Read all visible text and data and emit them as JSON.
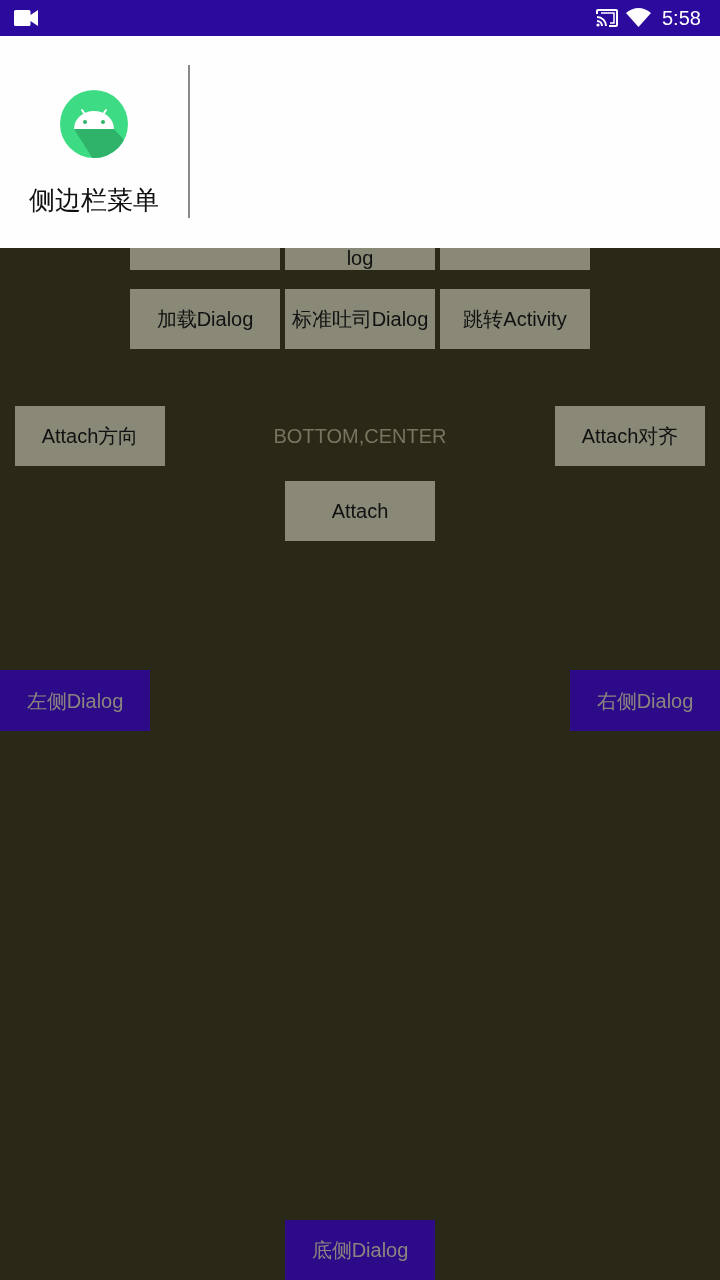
{
  "status_bar": {
    "time": "5:58"
  },
  "drawer": {
    "title": "侧边栏菜单"
  },
  "button_grid": [
    {
      "buttons": [
        {
          "covered": true
        },
        {
          "covered": true,
          "label": "log"
        },
        {
          "covered": true
        }
      ]
    },
    {
      "buttons": [
        {
          "covered": false,
          "label": "加载Dialog"
        },
        {
          "covered": false,
          "label": "标准吐司Dialog"
        },
        {
          "covered": false,
          "label": "跳转Activity"
        }
      ]
    }
  ],
  "attach": {
    "direction_button": "Attach方向",
    "value": "BOTTOM,CENTER",
    "align_button": "Attach对齐",
    "attach_button": "Attach"
  },
  "side_dialogs": {
    "left": "左侧Dialog",
    "right": "右侧Dialog",
    "bottom": "底侧Dialog"
  }
}
